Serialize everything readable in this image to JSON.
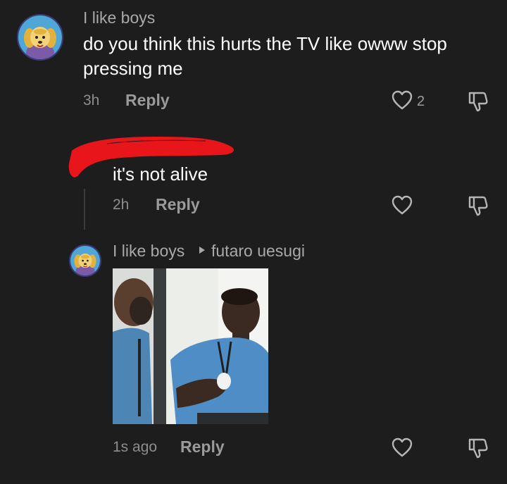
{
  "comments": [
    {
      "username": "I like boys",
      "text_line1": "do you think this hurts the TV like owww stop",
      "text_line2": "pressing me",
      "time": "3h",
      "reply_label": "Reply",
      "likes": "2"
    },
    {
      "username": "",
      "text": "it's not alive",
      "time": "2h",
      "reply_label": "Reply"
    },
    {
      "username": "I like boys",
      "reply_to": "futaro uesugi",
      "time": "1s ago",
      "reply_label": "Reply"
    }
  ],
  "colors": {
    "background": "#1d1d1d",
    "redaction": "#e8151b",
    "icon": "#b5b5b5"
  },
  "icons": [
    "heart-icon",
    "dislike-icon",
    "caret-right-icon"
  ]
}
